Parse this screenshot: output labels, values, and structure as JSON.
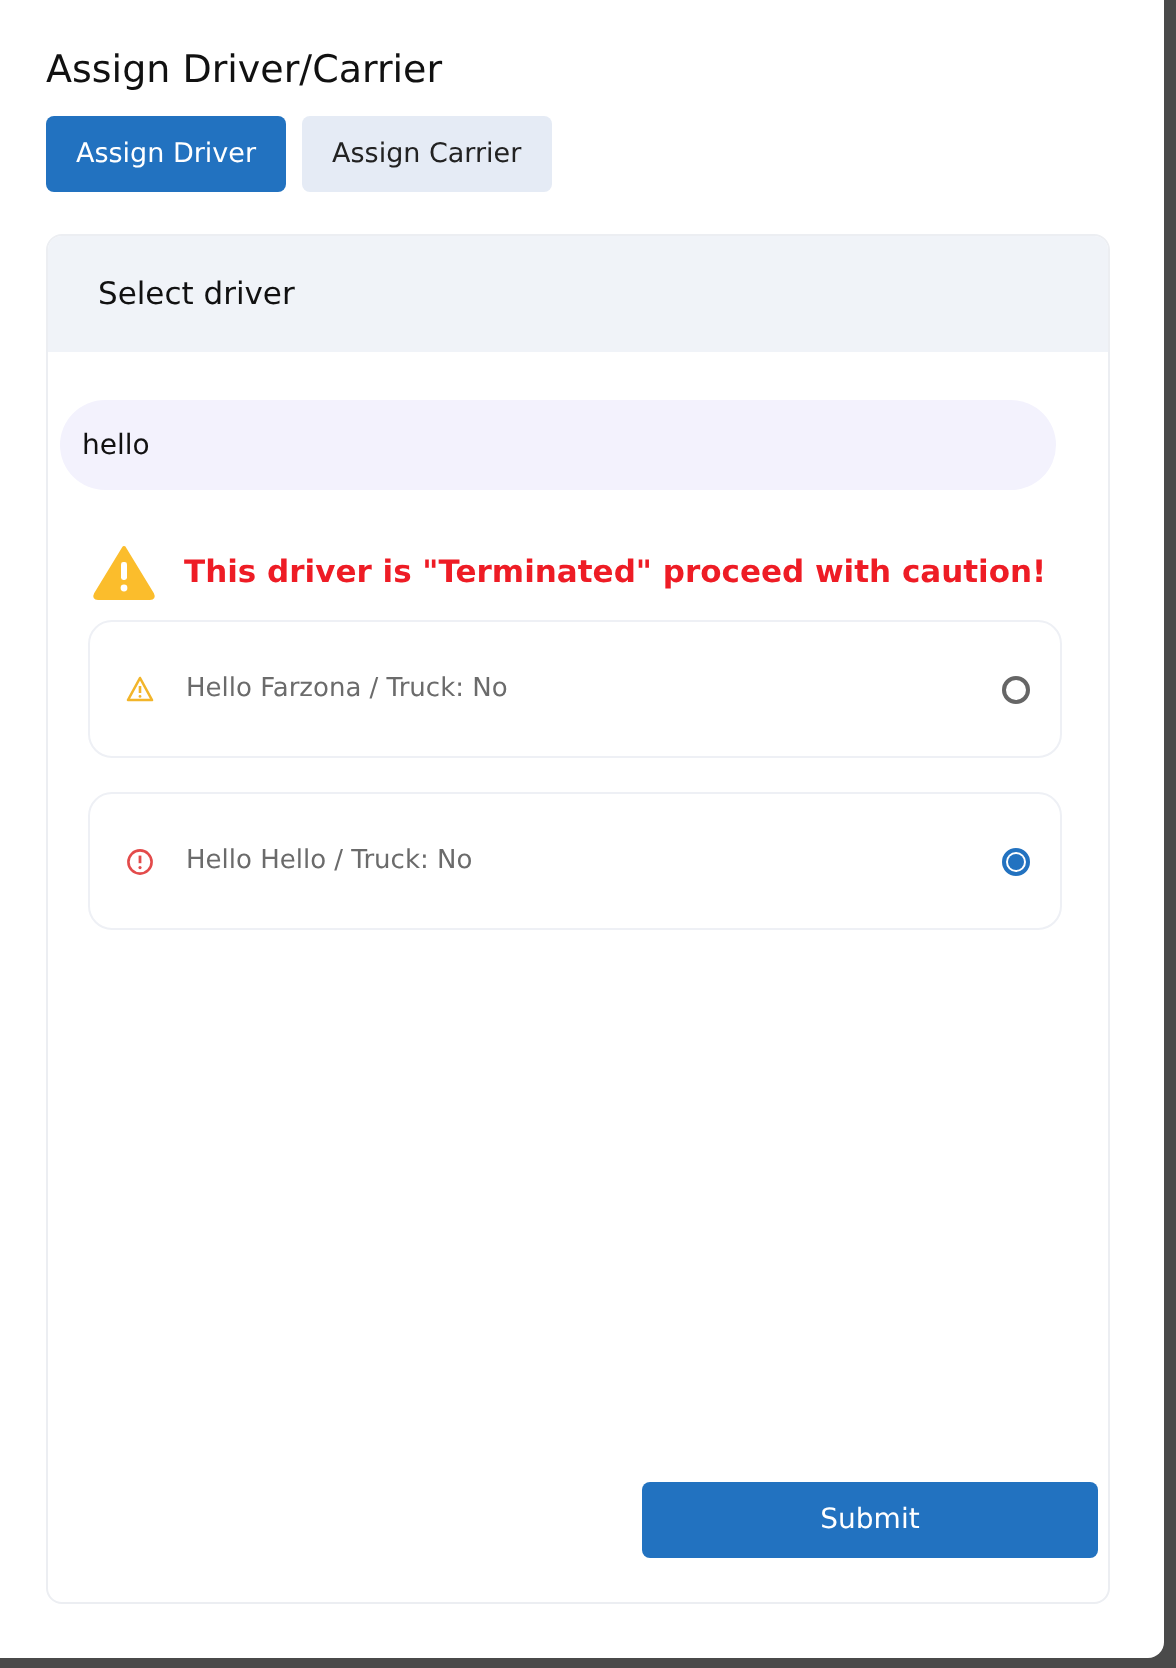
{
  "modal": {
    "title": "Assign Driver/Carrier"
  },
  "tabs": [
    {
      "label": "Assign Driver",
      "selected": true
    },
    {
      "label": "Assign Carrier",
      "selected": false
    }
  ],
  "panel": {
    "heading": "Select driver",
    "search": {
      "value": "hello"
    },
    "alert": {
      "kind": "warning",
      "text": "This driver is \"Terminated\" proceed with caution!"
    },
    "drivers": [
      {
        "kind": "warning",
        "label": "Hello Farzona / Truck: No",
        "selected": false
      },
      {
        "kind": "error",
        "label": "Hello Hello / Truck: No",
        "selected": true
      }
    ],
    "submit": "Submit"
  }
}
